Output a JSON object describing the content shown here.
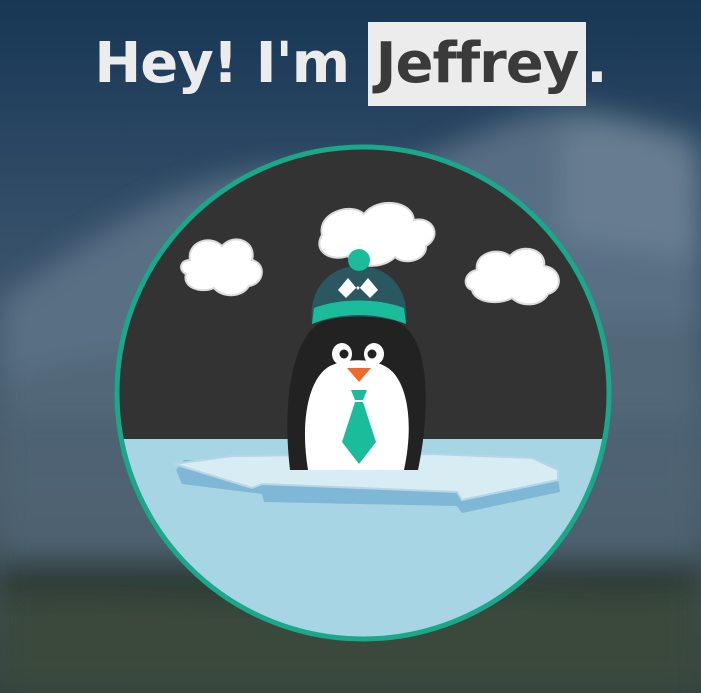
{
  "hero": {
    "greeting": "Hey! I'm",
    "name": "Jeffrey",
    "punctuation": "."
  },
  "avatar": {
    "subject": "penguin-on-ice-floe",
    "icons": [
      "cloud-icon",
      "beanie-hat-icon",
      "penguin-icon",
      "tie-icon",
      "ice-floe-icon"
    ]
  },
  "colors": {
    "accent": "#1abc9c",
    "headline_text": "#ececec",
    "name_highlight_bg": "#ececec",
    "name_text": "#3a3a3a",
    "avatar_sky": "#333333",
    "avatar_water": "#a8d5e4",
    "avatar_border": "#1aa88a"
  }
}
